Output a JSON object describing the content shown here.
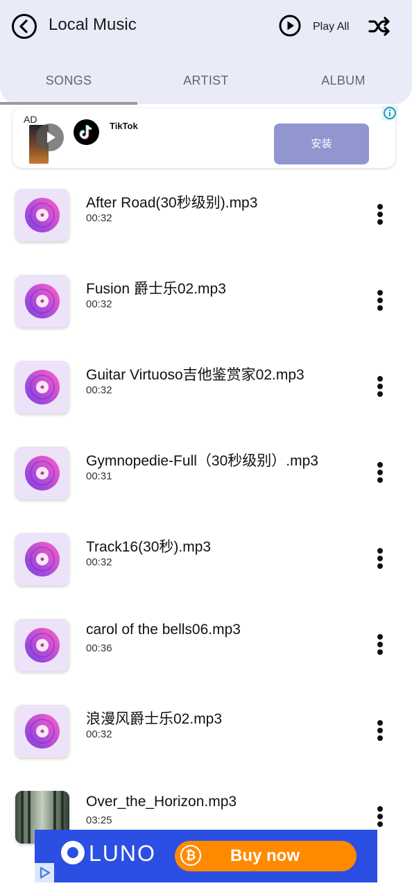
{
  "header": {
    "title": "Local Music",
    "play_all_label": "Play All",
    "tabs": [
      {
        "label": "SONGS",
        "active": true
      },
      {
        "label": "ARTIST",
        "active": false
      },
      {
        "label": "ALBUM",
        "active": false
      }
    ]
  },
  "ad": {
    "badge": "AD",
    "app_name": "TikTok",
    "install_label": "安装"
  },
  "songs": [
    {
      "title": "After Road(30秒级别).mp3",
      "duration": "00:32",
      "thumb": "disc-icon"
    },
    {
      "title": "Fusion 爵士乐02.mp3",
      "duration": "00:32",
      "thumb": "disc-icon"
    },
    {
      "title": "Guitar Virtuoso吉他鉴赏家02.mp3",
      "duration": "00:32",
      "thumb": "disc-icon"
    },
    {
      "title": "Gymnopedie-Full（30秒级别）.mp3",
      "duration": "00:31",
      "thumb": "disc-icon"
    },
    {
      "title": "Track16(30秒).mp3",
      "duration": "00:32",
      "thumb": "disc-icon"
    },
    {
      "title": "carol of the bells06.mp3",
      "duration": "00:36",
      "thumb": "disc-icon"
    },
    {
      "title": "浪漫风爵士乐02.mp3",
      "duration": "00:32",
      "thumb": "disc-icon"
    },
    {
      "title": "Over_the_Horizon.mp3",
      "duration": "03:25",
      "thumb": "album-art"
    }
  ],
  "bottom_ad": {
    "brand": "LUNO",
    "button_label": "Buy now",
    "button_icon": "₿"
  },
  "colors": {
    "header_bg": "#e9ebf8",
    "install_button": "#9196d0",
    "disc_purple": "#7b3fe4",
    "disc_pink": "#ff5fc6",
    "luno_blue": "#2c4fe3",
    "buy_orange": "#ff8a00"
  }
}
